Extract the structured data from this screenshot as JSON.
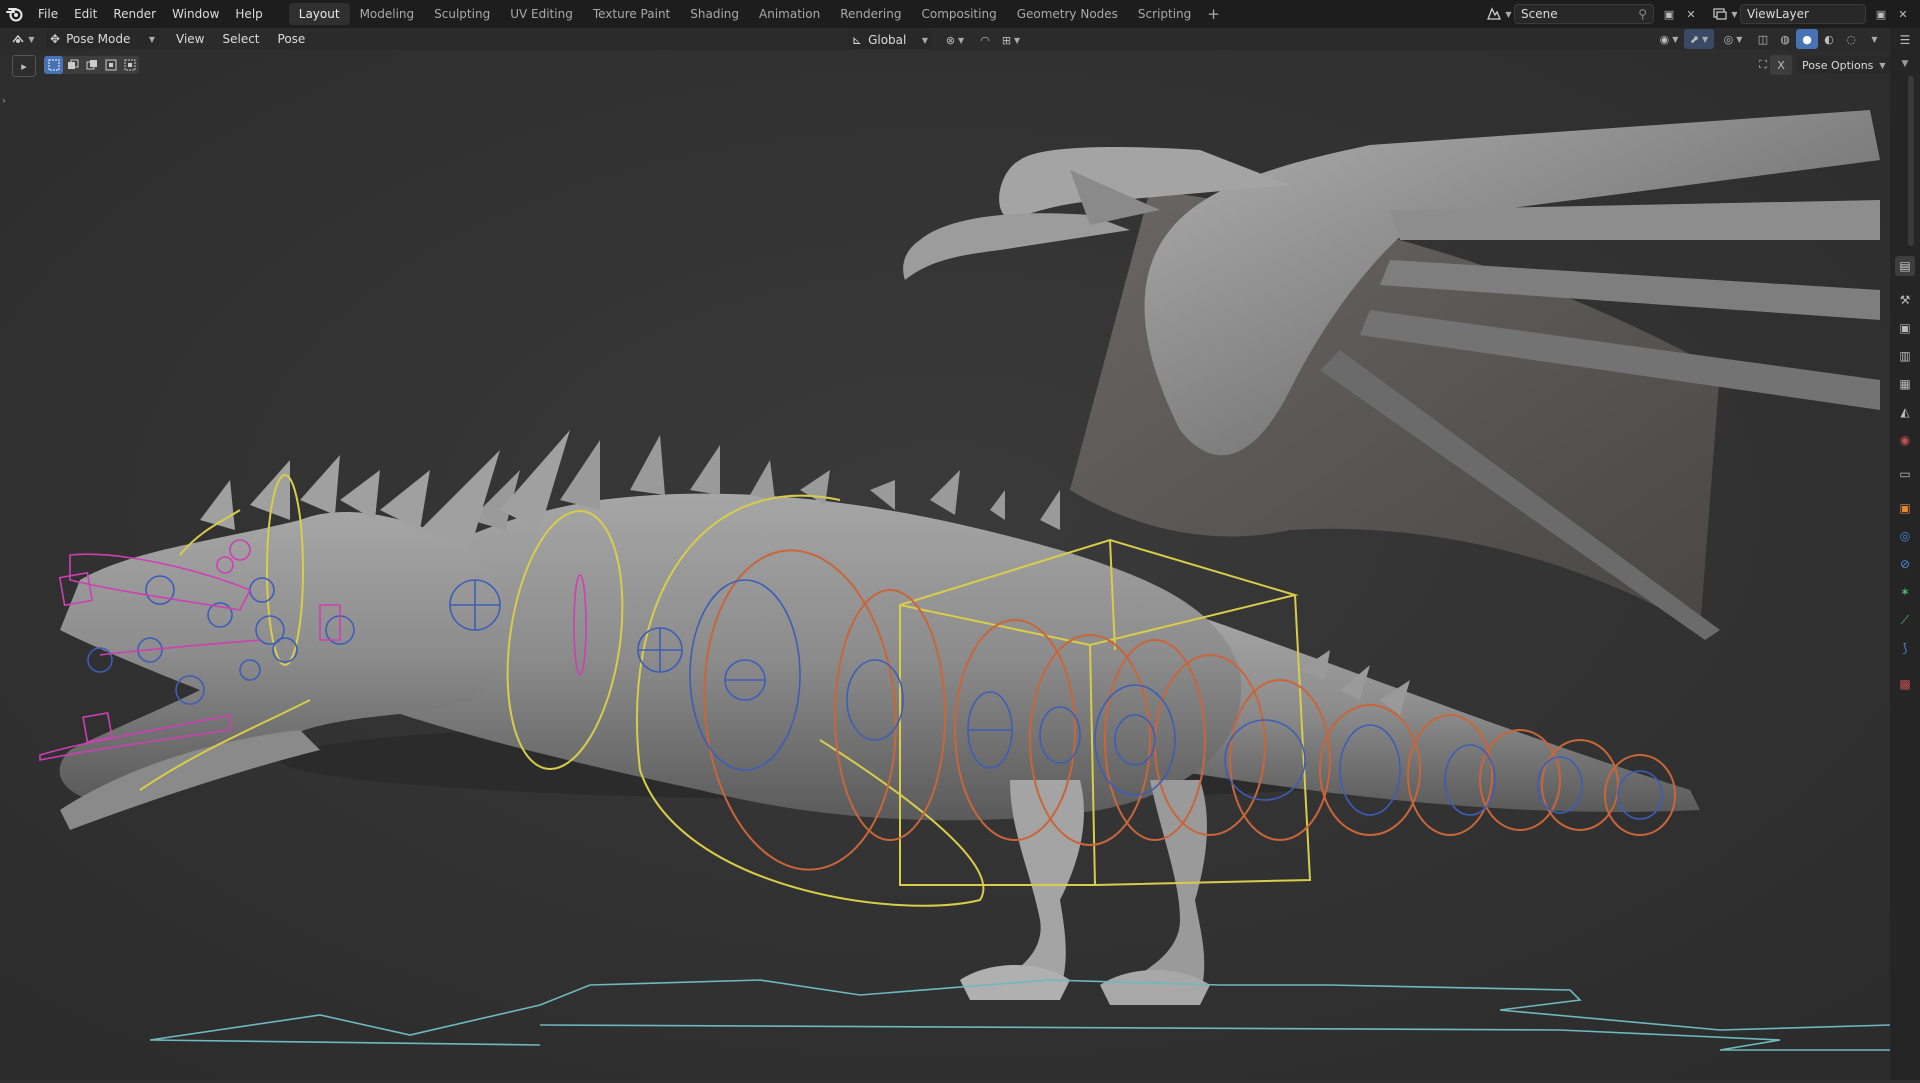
{
  "topbar": {
    "menus": [
      "File",
      "Edit",
      "Render",
      "Window",
      "Help"
    ],
    "workspaces": [
      "Layout",
      "Modeling",
      "Sculpting",
      "UV Editing",
      "Texture Paint",
      "Shading",
      "Animation",
      "Rendering",
      "Compositing",
      "Geometry Nodes",
      "Scripting"
    ],
    "active_workspace": "Layout",
    "add_workspace_glyph": "+",
    "scene_name": "Scene",
    "view_layer_name": "ViewLayer"
  },
  "viewport_header": {
    "mode": "Pose Mode",
    "menus": [
      "View",
      "Select",
      "Pose"
    ],
    "transform_orientation": "Global",
    "pose_options": "Pose Options"
  },
  "icons": {
    "blender": "blender-logo-icon",
    "editor_type": "3d-viewport-icon",
    "pose_mode": "pose-mode-icon",
    "orientation": "global-axis-icon",
    "pivot": "pivot-point-icon",
    "snap": "snap-magnet-icon",
    "scene": "scene-icon",
    "view_layer": "view-layer-icon"
  },
  "properties_tabs": [
    "tool",
    "render",
    "output",
    "view-layer",
    "scene",
    "world",
    "collection",
    "object",
    "modifiers",
    "particles",
    "physics",
    "constraints",
    "object-data-armature",
    "bone",
    "bone-constraints",
    "texture"
  ],
  "colors": {
    "topbar_bg": "#1d1d1d",
    "viewport_bg": "#303030",
    "active_blue": "#4772b3",
    "bone_yellow": "#d8cc4a",
    "bone_orange": "#c8663a",
    "bone_blue": "#3d5eb8",
    "bone_magenta": "#cf3fb4",
    "ground_cyan": "#6fb8c0",
    "mesh_gray": "#8a8a8a"
  }
}
